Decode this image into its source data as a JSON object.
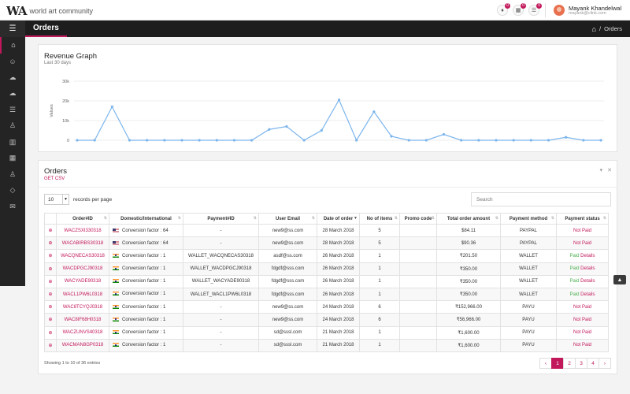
{
  "header": {
    "logo_mark": "WA",
    "logo_text": "world art community",
    "notifications": [
      {
        "icon": "bell-icon",
        "count": "0"
      },
      {
        "icon": "calendar-icon",
        "count": "0"
      },
      {
        "icon": "list-icon",
        "count": "0"
      }
    ],
    "user_name": "Mayank Khandelwal",
    "user_email": "mayank@clink.com"
  },
  "navbar": {
    "page_title": "Orders",
    "breadcrumb_sep": "/",
    "breadcrumb_current": "Orders"
  },
  "sidebar": {
    "items": [
      {
        "name": "home-icon",
        "glyph": "⌂"
      },
      {
        "name": "user-icon",
        "glyph": "☺"
      },
      {
        "name": "cloud-download-icon",
        "glyph": "☁"
      },
      {
        "name": "cloud-upload-icon",
        "glyph": "☁"
      },
      {
        "name": "list-icon",
        "glyph": "☰"
      },
      {
        "name": "user-settings-icon",
        "glyph": "♙"
      },
      {
        "name": "bar-chart-icon",
        "glyph": "▥"
      },
      {
        "name": "table-icon",
        "glyph": "▦"
      },
      {
        "name": "person-icon",
        "glyph": "♙"
      },
      {
        "name": "tag-icon",
        "glyph": "◇"
      },
      {
        "name": "mail-icon",
        "glyph": "✉"
      }
    ]
  },
  "revenue": {
    "title": "Revenue Graph",
    "subtitle": "Last 30 days"
  },
  "chart_data": {
    "type": "line",
    "ylabel": "Values",
    "ylim": [
      0,
      30000
    ],
    "ytick_labels": [
      "0",
      "10k",
      "20k",
      "30k"
    ],
    "yticks": [
      0,
      10000,
      20000,
      30000
    ],
    "values": [
      0,
      0,
      17000,
      0,
      0,
      0,
      0,
      0,
      0,
      0,
      0,
      5500,
      7000,
      0,
      5000,
      20500,
      0,
      14500,
      2000,
      0,
      0,
      3000,
      0,
      0,
      0,
      0,
      0,
      0,
      1500,
      0,
      0
    ],
    "grid": true,
    "color": "#7cb5ec"
  },
  "orders": {
    "title": "Orders",
    "csv_label": "GET CSV",
    "page_length": "10",
    "length_label": "records per page",
    "search_placeholder": "Search",
    "columns": [
      "",
      "Order#ID",
      "Domestic/International",
      "Payment#ID",
      "User Email",
      "Date of order",
      "No of items",
      "Promo code",
      "Total order amount",
      "Payment method",
      "Payment status"
    ],
    "rows": [
      {
        "id": "WACZSXI330318",
        "flag": "us",
        "conv": "Conversion factor : 64",
        "pay_id": "-",
        "email": "new9@ss.com",
        "date": "28 March 2018",
        "items": "5",
        "promo": "",
        "amount": "$84.11",
        "method": "PAYPAL",
        "status": "Not Paid",
        "paid": false
      },
      {
        "id": "WACABIRBS30318",
        "flag": "us",
        "conv": "Conversion factor : 64",
        "pay_id": "-",
        "email": "new9@ss.com",
        "date": "28 March 2018",
        "items": "5",
        "promo": "",
        "amount": "$90.36",
        "method": "PAYPAL",
        "status": "Not Paid",
        "paid": false
      },
      {
        "id": "WACQNECAS30318",
        "flag": "in",
        "conv": "Conversion factor : 1",
        "pay_id": "WALLET_WACQNECAS30318",
        "email": "asdf@ss.com",
        "date": "26 March 2018",
        "items": "1",
        "promo": "",
        "amount": "₹201.50",
        "method": "WALLET",
        "status": "Paid",
        "details": "Details",
        "paid": true
      },
      {
        "id": "WACDPGCJ90318",
        "flag": "in",
        "conv": "Conversion factor : 1",
        "pay_id": "WALLET_WACDPGCJ90318",
        "email": "fdgdf@sss.com",
        "date": "26 March 2018",
        "items": "1",
        "promo": "",
        "amount": "₹350.00",
        "method": "WALLET",
        "status": "Paid",
        "details": "Details",
        "paid": true
      },
      {
        "id": "WACYADE90318",
        "flag": "in",
        "conv": "Conversion factor : 1",
        "pay_id": "WALLET_WACYADE90318",
        "email": "fdgdf@sss.com",
        "date": "26 March 2018",
        "items": "1",
        "promo": "",
        "amount": "₹350.00",
        "method": "WALLET",
        "status": "Paid",
        "details": "Details",
        "paid": true
      },
      {
        "id": "WACL1PW6L0318",
        "flag": "in",
        "conv": "Conversion factor : 1",
        "pay_id": "WALLET_WACL1PW6L0318",
        "email": "fdgdf@sss.com",
        "date": "26 March 2018",
        "items": "1",
        "promo": "",
        "amount": "₹350.00",
        "method": "WALLET",
        "status": "Paid",
        "details": "Details",
        "paid": true
      },
      {
        "id": "WAC8TCYQJ0318",
        "flag": "in",
        "conv": "Conversion factor : 1",
        "pay_id": "-",
        "email": "new9@ss.com",
        "date": "24 March 2018",
        "items": "6",
        "promo": "",
        "amount": "₹152,966.00",
        "method": "PAYU",
        "status": "Not Paid",
        "paid": false
      },
      {
        "id": "WAC8IF68H0318",
        "flag": "in",
        "conv": "Conversion factor : 1",
        "pay_id": "-",
        "email": "new9@ss.com",
        "date": "24 March 2018",
        "items": "6",
        "promo": "",
        "amount": "₹56,966.00",
        "method": "PAYU",
        "status": "Not Paid",
        "paid": false
      },
      {
        "id": "WACZUNVS40318",
        "flag": "in",
        "conv": "Conversion factor : 1",
        "pay_id": "-",
        "email": "sd@sssl.com",
        "date": "21 March 2018",
        "items": "1",
        "promo": "",
        "amount": "₹1,600.00",
        "method": "PAYU",
        "status": "Not Paid",
        "paid": false
      },
      {
        "id": "WACMAN8GP0318",
        "flag": "in",
        "conv": "Conversion factor : 1",
        "pay_id": "-",
        "email": "sd@sssl.com",
        "date": "21 March 2018",
        "items": "1",
        "promo": "",
        "amount": "₹1,600.00",
        "method": "PAYU",
        "status": "Not Paid",
        "paid": false
      }
    ],
    "info": "Showing 1 to 10 of 36 entries",
    "pages": [
      "‹",
      "1",
      "2",
      "3",
      "4",
      "›"
    ],
    "active_page": "1"
  },
  "colors": {
    "accent": "#c2185b",
    "paid": "#4caf50",
    "nav_bg": "#1d1d1d",
    "sidebar_bg": "#242424"
  }
}
